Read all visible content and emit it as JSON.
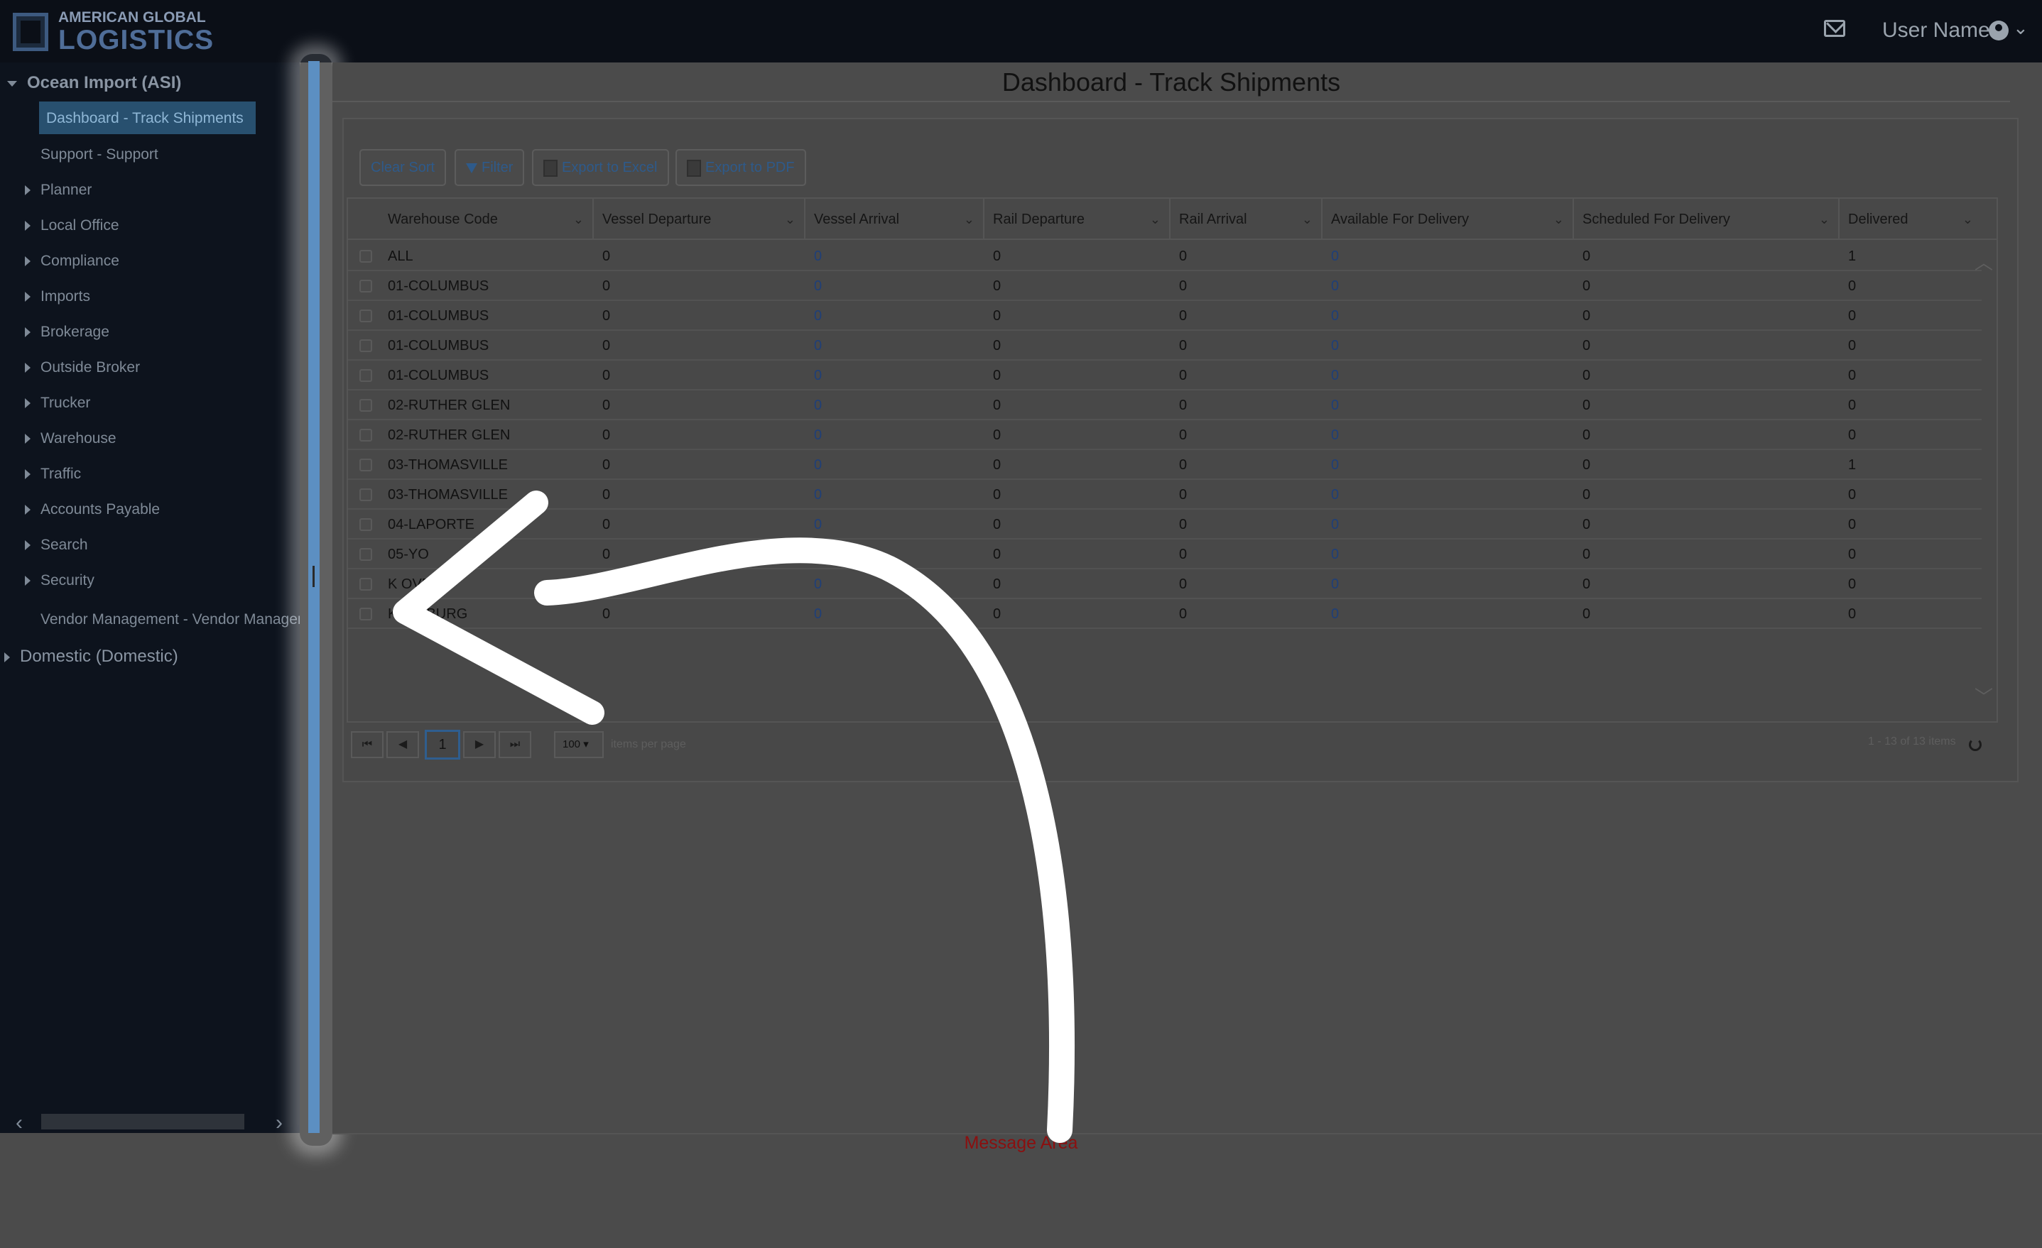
{
  "brand": {
    "line1": "AMERICAN GLOBAL",
    "line2": "LOGISTICS"
  },
  "header": {
    "user_name": "User Name",
    "user_chevron": "⌄"
  },
  "sidebar": {
    "group_open": "Ocean Import (ASI)",
    "active_item": "Dashboard - Track Shipments",
    "items": [
      {
        "label": "Support - Support"
      },
      {
        "label": "Planner"
      },
      {
        "label": "Local Office"
      },
      {
        "label": "Compliance"
      },
      {
        "label": "Imports"
      },
      {
        "label": "Brokerage"
      },
      {
        "label": "Outside Broker"
      },
      {
        "label": "Trucker"
      },
      {
        "label": "Warehouse"
      },
      {
        "label": "Traffic"
      },
      {
        "label": "Accounts Payable"
      },
      {
        "label": "Search"
      },
      {
        "label": "Security"
      },
      {
        "label": "Vendor Management - Vendor Management"
      }
    ],
    "group_closed": "Domestic (Domestic)"
  },
  "page": {
    "title": "Dashboard - Track Shipments"
  },
  "toolbar": {
    "clear_sort": "Clear Sort",
    "filter": "Filter",
    "export_excel": "Export to Excel",
    "export_pdf": "Export to PDF"
  },
  "grid": {
    "columns": [
      "Warehouse Code",
      "Vessel Departure",
      "Vessel Arrival",
      "Rail Departure",
      "Rail Arrival",
      "Available For Delivery",
      "Scheduled For Delivery",
      "Delivered"
    ],
    "rows": [
      [
        "ALL",
        "0",
        "0",
        "0",
        "0",
        "0",
        "0",
        "1"
      ],
      [
        "01-COLUMBUS",
        "0",
        "0",
        "0",
        "0",
        "0",
        "0",
        "0"
      ],
      [
        "01-COLUMBUS",
        "0",
        "0",
        "0",
        "0",
        "0",
        "0",
        "0"
      ],
      [
        "01-COLUMBUS",
        "0",
        "0",
        "0",
        "0",
        "0",
        "0",
        "0"
      ],
      [
        "01-COLUMBUS",
        "0",
        "0",
        "0",
        "0",
        "0",
        "0",
        "0"
      ],
      [
        "02-RUTHER GLEN",
        "0",
        "0",
        "0",
        "0",
        "0",
        "0",
        "0"
      ],
      [
        "02-RUTHER GLEN",
        "0",
        "0",
        "0",
        "0",
        "0",
        "0",
        "0"
      ],
      [
        "03-THOMASVILLE",
        "0",
        "0",
        "0",
        "0",
        "0",
        "0",
        "1"
      ],
      [
        "03-THOMASVILLE",
        "0",
        "0",
        "0",
        "0",
        "0",
        "0",
        "0"
      ],
      [
        "04-LAPORTE",
        "0",
        "0",
        "0",
        "0",
        "0",
        "0",
        "0"
      ],
      [
        "05-YO",
        "0",
        "0",
        "0",
        "0",
        "0",
        "0",
        "0"
      ],
      [
        "K      OVER",
        "0",
        "0",
        "0",
        "0",
        "0",
        "0",
        "0"
      ],
      [
        "      KERSBURG",
        "0",
        "0",
        "0",
        "0",
        "0",
        "0",
        "0"
      ]
    ]
  },
  "pager": {
    "current_page": "1",
    "page_size": "100",
    "page_size_label": "items per page",
    "info": "1 - 13 of 13 items"
  },
  "message_area": "Message Area",
  "colors": {
    "accent": "#5c8fc2",
    "link": "#1f3f78",
    "message": "#8b0f0f"
  },
  "icons": [
    "mail-icon",
    "user-circle-icon",
    "refresh-icon",
    "filter-icon",
    "excel-icon",
    "pdf-icon"
  ]
}
